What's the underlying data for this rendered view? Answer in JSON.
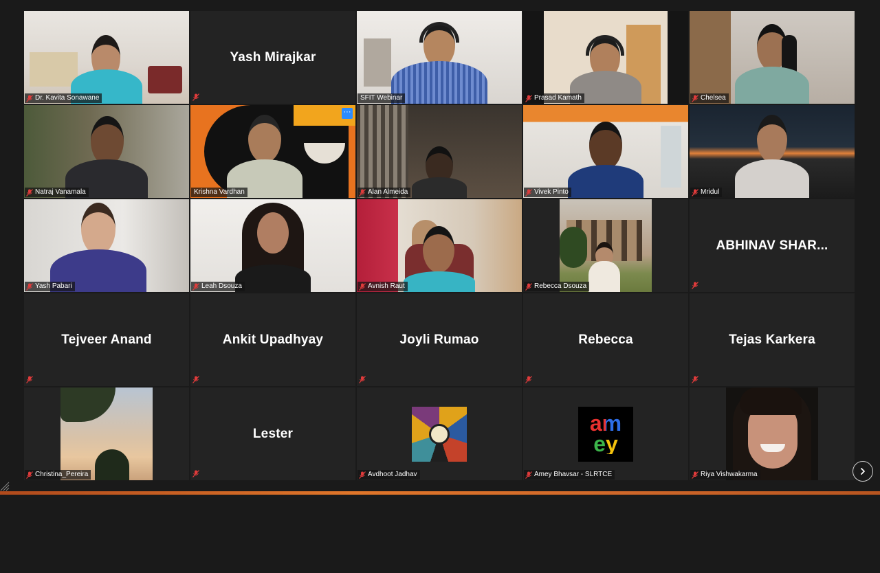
{
  "participants": [
    {
      "name": "Dr. Kavita Sonawane",
      "muted": true,
      "video": true
    },
    {
      "name": "Yash Mirajkar",
      "muted": true,
      "video": false
    },
    {
      "name": "SFIT Webinar",
      "muted": false,
      "video": true
    },
    {
      "name": "Prasad Kamath",
      "muted": true,
      "video": true
    },
    {
      "name": "Chelsea",
      "muted": true,
      "video": true
    },
    {
      "name": "Natraj Vanamala",
      "muted": true,
      "video": true
    },
    {
      "name": "Krishna Vardhan",
      "muted": false,
      "video": true,
      "active_speaker": true
    },
    {
      "name": "Alan Almeida",
      "muted": true,
      "video": true
    },
    {
      "name": "Vivek Pinto",
      "muted": true,
      "video": true
    },
    {
      "name": "Mridul",
      "muted": true,
      "video": true
    },
    {
      "name": "Yash Pabari",
      "muted": true,
      "video": true
    },
    {
      "name": "Leah Dsouza",
      "muted": true,
      "video": true
    },
    {
      "name": "Avnish Raut",
      "muted": true,
      "video": true
    },
    {
      "name": "Rebecca Dsouza",
      "muted": true,
      "video": true
    },
    {
      "name": "ABHINAV  SHAR...",
      "muted": true,
      "video": false
    },
    {
      "name": "Tejveer Anand",
      "muted": true,
      "video": false
    },
    {
      "name": "Ankit Upadhyay",
      "muted": true,
      "video": false
    },
    {
      "name": "Joyli Rumao",
      "muted": true,
      "video": false
    },
    {
      "name": "Rebecca",
      "muted": true,
      "video": false
    },
    {
      "name": "Tejas Karkera",
      "muted": true,
      "video": false
    },
    {
      "name": "Christina_Pereira",
      "muted": true,
      "video": true
    },
    {
      "name": "Lester",
      "muted": true,
      "video": false
    },
    {
      "name": "Avdhoot Jadhav",
      "muted": true,
      "video": true
    },
    {
      "name": "Amey Bhavsar - SLRTCE",
      "muted": true,
      "video": true
    },
    {
      "name": "Riya Vishwakarma",
      "muted": true,
      "video": true
    }
  ],
  "controls": {
    "more_label": "···",
    "next_page_icon": "chevron-right-icon"
  },
  "amey_logo": {
    "l1": "am",
    "l2": "ey"
  },
  "colors": {
    "background": "#1a1a1a",
    "tile": "#232323",
    "active_border": "#e8dd57",
    "accent": "#2d8cff",
    "muted_icon": "#e03b3b"
  }
}
